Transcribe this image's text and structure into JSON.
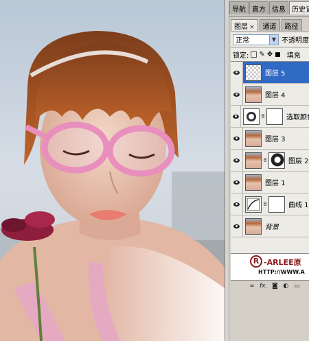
{
  "panel_tabs": [
    {
      "label": "导航"
    },
    {
      "label": "直方"
    },
    {
      "label": "信息"
    },
    {
      "label": "历史记录"
    }
  ],
  "layer_panel_tabs": [
    {
      "label": "图层",
      "close": "×"
    },
    {
      "label": "通道"
    },
    {
      "label": "路径"
    }
  ],
  "blend_mode": "正常",
  "opacity_label": "不透明度",
  "lock_label": "锁定:",
  "fill_label": "填充",
  "layers": [
    {
      "name": "图层 5",
      "selected": true,
      "thumb": "transparent-icon"
    },
    {
      "name": "图层 4",
      "thumb": "photo-icon"
    },
    {
      "name": "选取颜色",
      "thumb": "selective-color-adjustment-icon",
      "mask": "white"
    },
    {
      "name": "图层 3",
      "thumb": "photo-icon"
    },
    {
      "name": "图层 2",
      "thumb": "photo-icon",
      "mask": "dark"
    },
    {
      "name": "图层 1",
      "thumb": "photo-icon"
    },
    {
      "name": "曲线 1",
      "thumb": "curves-adjustment-icon",
      "mask": "white"
    },
    {
      "name": "背景",
      "thumb": "photo-icon"
    }
  ],
  "watermark": {
    "symbol": "R",
    "brand": "-ARLEE原",
    "url": "HTTP://WWW.A"
  },
  "bottom_icons": [
    "link-icon",
    "fx-icon",
    "mask-icon",
    "adjustment-icon",
    "folder-icon"
  ],
  "fx_label": "fx."
}
